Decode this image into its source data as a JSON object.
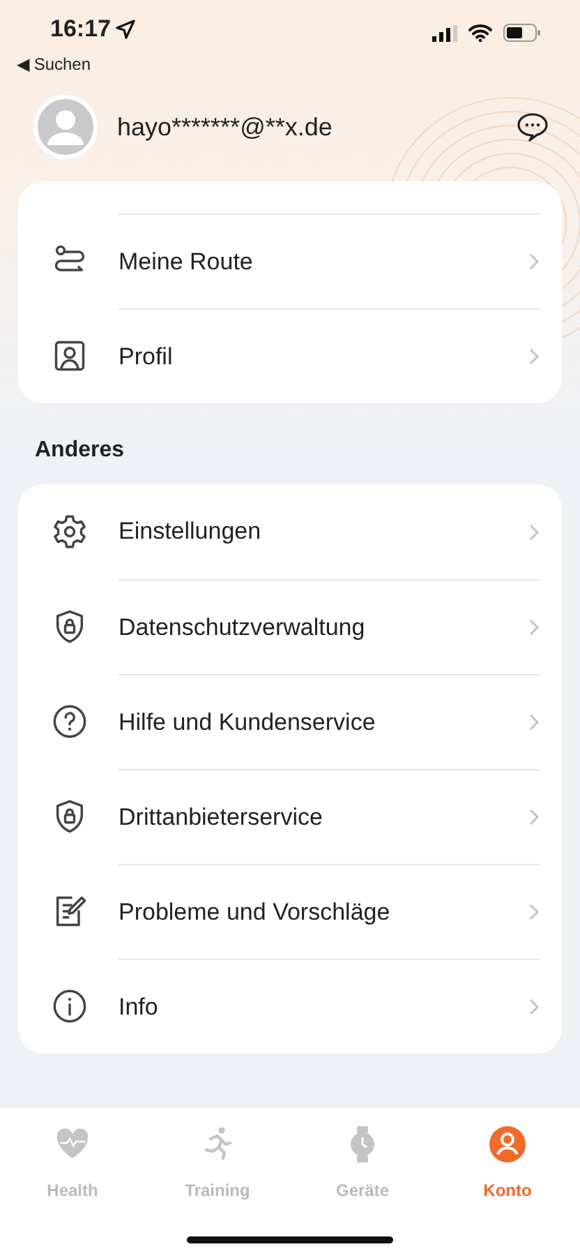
{
  "status_bar": {
    "time": "16:17",
    "back_link": "◀ Suchen"
  },
  "account": {
    "email": "hayo*******@**x.de"
  },
  "top_group": {
    "items": [
      {
        "label": "Meine Route"
      },
      {
        "label": "Profil"
      }
    ]
  },
  "other_section": {
    "title": "Anderes",
    "items": [
      {
        "label": "Einstellungen"
      },
      {
        "label": "Datenschutzverwaltung"
      },
      {
        "label": "Hilfe und Kundenservice"
      },
      {
        "label": "Drittanbieterservice"
      },
      {
        "label": "Probleme und Vorschläge"
      },
      {
        "label": "Info"
      }
    ]
  },
  "tab_bar": [
    {
      "label": "Health",
      "selected": false
    },
    {
      "label": "Training",
      "selected": false
    },
    {
      "label": "Geräte",
      "selected": false
    },
    {
      "label": "Konto",
      "selected": true
    }
  ]
}
